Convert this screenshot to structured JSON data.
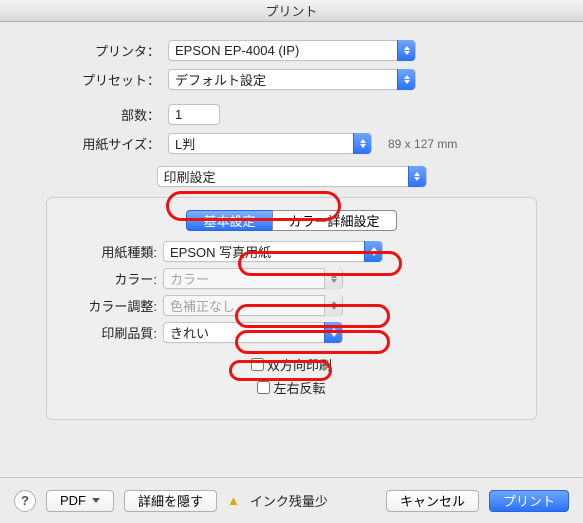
{
  "title": "プリント",
  "fields": {
    "printer_label": "プリンタ：",
    "printer_value": "EPSON EP-4004 (IP)",
    "preset_label": "プリセット：",
    "preset_value": "デフォルト設定",
    "copies_label": "部数：",
    "copies_value": "1",
    "paper_size_label": "用紙サイズ：",
    "paper_size_value": "L判",
    "paper_dim": "89 x 127 mm",
    "pane_value": "印刷設定"
  },
  "tabs": {
    "basic": "基本設定",
    "color_detail": "カラー詳細設定"
  },
  "settings": {
    "media_label": "用紙種類:",
    "media_value": "EPSON 写真用紙",
    "color_label": "カラー:",
    "color_value": "カラー",
    "color_adj_label": "カラー調整:",
    "color_adj_value": "色補正なし",
    "quality_label": "印刷品質:",
    "quality_value": "きれい",
    "bidir_label": "双方向印刷",
    "flip_label": "左右反転"
  },
  "footer": {
    "pdf": "PDF",
    "hide_details": "詳細を隠す",
    "ink_low": "インク残量少",
    "cancel": "キャンセル",
    "print": "プリント"
  }
}
